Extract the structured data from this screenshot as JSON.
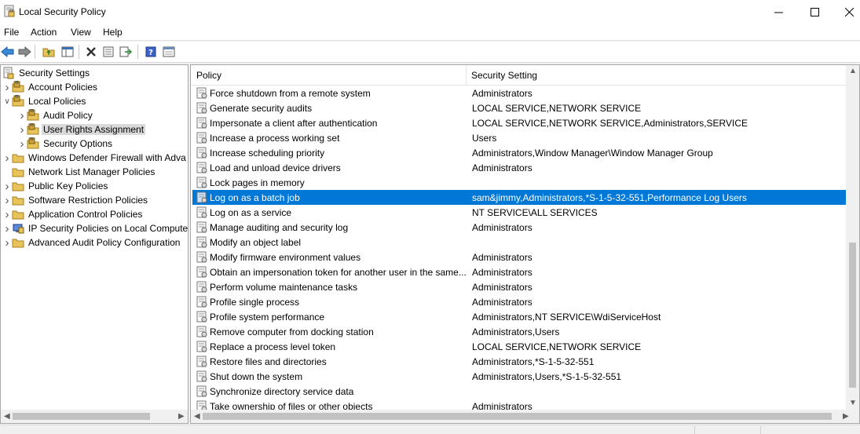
{
  "window": {
    "title": "Local Security Policy",
    "controls": [
      "minimize",
      "maximize",
      "close"
    ]
  },
  "menu": {
    "items": [
      "File",
      "Action",
      "View",
      "Help"
    ]
  },
  "toolbar": {
    "buttons": [
      "back-icon",
      "forward-icon",
      "up-folder-icon",
      "show-tree-icon",
      "delete-icon",
      "properties-icon",
      "export-list-icon",
      "help-icon",
      "mmc-view-icon"
    ]
  },
  "tree": {
    "root": "Security Settings",
    "items": [
      {
        "label": "Account Policies",
        "level": 1,
        "expanded": false
      },
      {
        "label": "Local Policies",
        "level": 1,
        "expanded": true
      },
      {
        "label": "Audit Policy",
        "level": 2,
        "expanded": false
      },
      {
        "label": "User Rights Assignment",
        "level": 2,
        "expanded": false,
        "selected": true
      },
      {
        "label": "Security Options",
        "level": 2,
        "expanded": false
      },
      {
        "label": "Windows Defender Firewall with Adva",
        "level": 1,
        "expanded": false
      },
      {
        "label": "Network List Manager Policies",
        "level": 1,
        "expanded": null
      },
      {
        "label": "Public Key Policies",
        "level": 1,
        "expanded": false
      },
      {
        "label": "Software Restriction Policies",
        "level": 1,
        "expanded": false
      },
      {
        "label": "Application Control Policies",
        "level": 1,
        "expanded": false
      },
      {
        "label": "IP Security Policies on Local Compute",
        "level": 1,
        "expanded": false
      },
      {
        "label": "Advanced Audit Policy Configuration",
        "level": 1,
        "expanded": false
      }
    ]
  },
  "list": {
    "columns": [
      "Policy",
      "Security Setting"
    ],
    "rows": [
      {
        "policy": "Force shutdown from a remote system",
        "setting": "Administrators"
      },
      {
        "policy": "Generate security audits",
        "setting": "LOCAL SERVICE,NETWORK SERVICE"
      },
      {
        "policy": "Impersonate a client after authentication",
        "setting": "LOCAL SERVICE,NETWORK SERVICE,Administrators,SERVICE"
      },
      {
        "policy": "Increase a process working set",
        "setting": "Users"
      },
      {
        "policy": "Increase scheduling priority",
        "setting": "Administrators,Window Manager\\Window Manager Group"
      },
      {
        "policy": "Load and unload device drivers",
        "setting": "Administrators"
      },
      {
        "policy": "Lock pages in memory",
        "setting": ""
      },
      {
        "policy": "Log on as a batch job",
        "setting": "sam&jimmy,Administrators,*S-1-5-32-551,Performance Log Users",
        "selected": true
      },
      {
        "policy": "Log on as a service",
        "setting": "NT SERVICE\\ALL SERVICES"
      },
      {
        "policy": "Manage auditing and security log",
        "setting": "Administrators"
      },
      {
        "policy": "Modify an object label",
        "setting": ""
      },
      {
        "policy": "Modify firmware environment values",
        "setting": "Administrators"
      },
      {
        "policy": "Obtain an impersonation token for another user in the same...",
        "setting": "Administrators"
      },
      {
        "policy": "Perform volume maintenance tasks",
        "setting": "Administrators"
      },
      {
        "policy": "Profile single process",
        "setting": "Administrators"
      },
      {
        "policy": "Profile system performance",
        "setting": "Administrators,NT SERVICE\\WdiServiceHost"
      },
      {
        "policy": "Remove computer from docking station",
        "setting": "Administrators,Users"
      },
      {
        "policy": "Replace a process level token",
        "setting": "LOCAL SERVICE,NETWORK SERVICE"
      },
      {
        "policy": "Restore files and directories",
        "setting": "Administrators,*S-1-5-32-551"
      },
      {
        "policy": "Shut down the system",
        "setting": "Administrators,Users,*S-1-5-32-551"
      },
      {
        "policy": "Synchronize directory service data",
        "setting": ""
      },
      {
        "policy": "Take ownership of files or other objects",
        "setting": "Administrators"
      }
    ]
  },
  "colors": {
    "selection": "#0078d7",
    "tree_selection": "#d9d9d9",
    "folder": "#e8c35a"
  }
}
